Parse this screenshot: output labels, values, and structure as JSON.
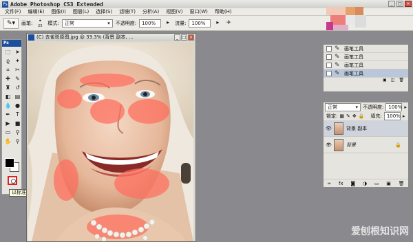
{
  "app": {
    "title": "Adobe Photoshop CS3 Extended",
    "logo_text": "Ps"
  },
  "menu": [
    "文件(F)",
    "编辑(E)",
    "图像(I)",
    "图层(L)",
    "选择(S)",
    "滤镜(T)",
    "分析(A)",
    "视图(V)",
    "窗口(W)",
    "帮助(H)"
  ],
  "options": {
    "brush_label": "画笔:",
    "brush_size": "25",
    "mode_label": "模式:",
    "mode_value": "正常",
    "opacity_label": "不透明度:",
    "opacity_value": "100%",
    "flow_label": "流量:",
    "flow_value": "100%"
  },
  "toolbox": {
    "header": "Ps"
  },
  "tooltip": "以标准模式编辑 (Q)",
  "document": {
    "title": "(C) 去雀斑原图.jpg @ 33.3% (背景 副本, ..."
  },
  "history": {
    "items": [
      "画笔工具",
      "画笔工具",
      "画笔工具",
      "画笔工具"
    ]
  },
  "layers": {
    "blend_mode": "正常",
    "opacity_label": "不透明度:",
    "opacity_value": "100%",
    "lock_label": "锁定:",
    "fill_label": "填充:",
    "fill_value": "100%",
    "rows": [
      {
        "name": "背景 副本"
      },
      {
        "name": "背景"
      }
    ]
  },
  "watermark": "爱刨根知识网",
  "colors": {
    "mask_overlay": "#ff6e5e",
    "ps_blue": "#1c4e9c",
    "selection": "#b9c6dc"
  }
}
